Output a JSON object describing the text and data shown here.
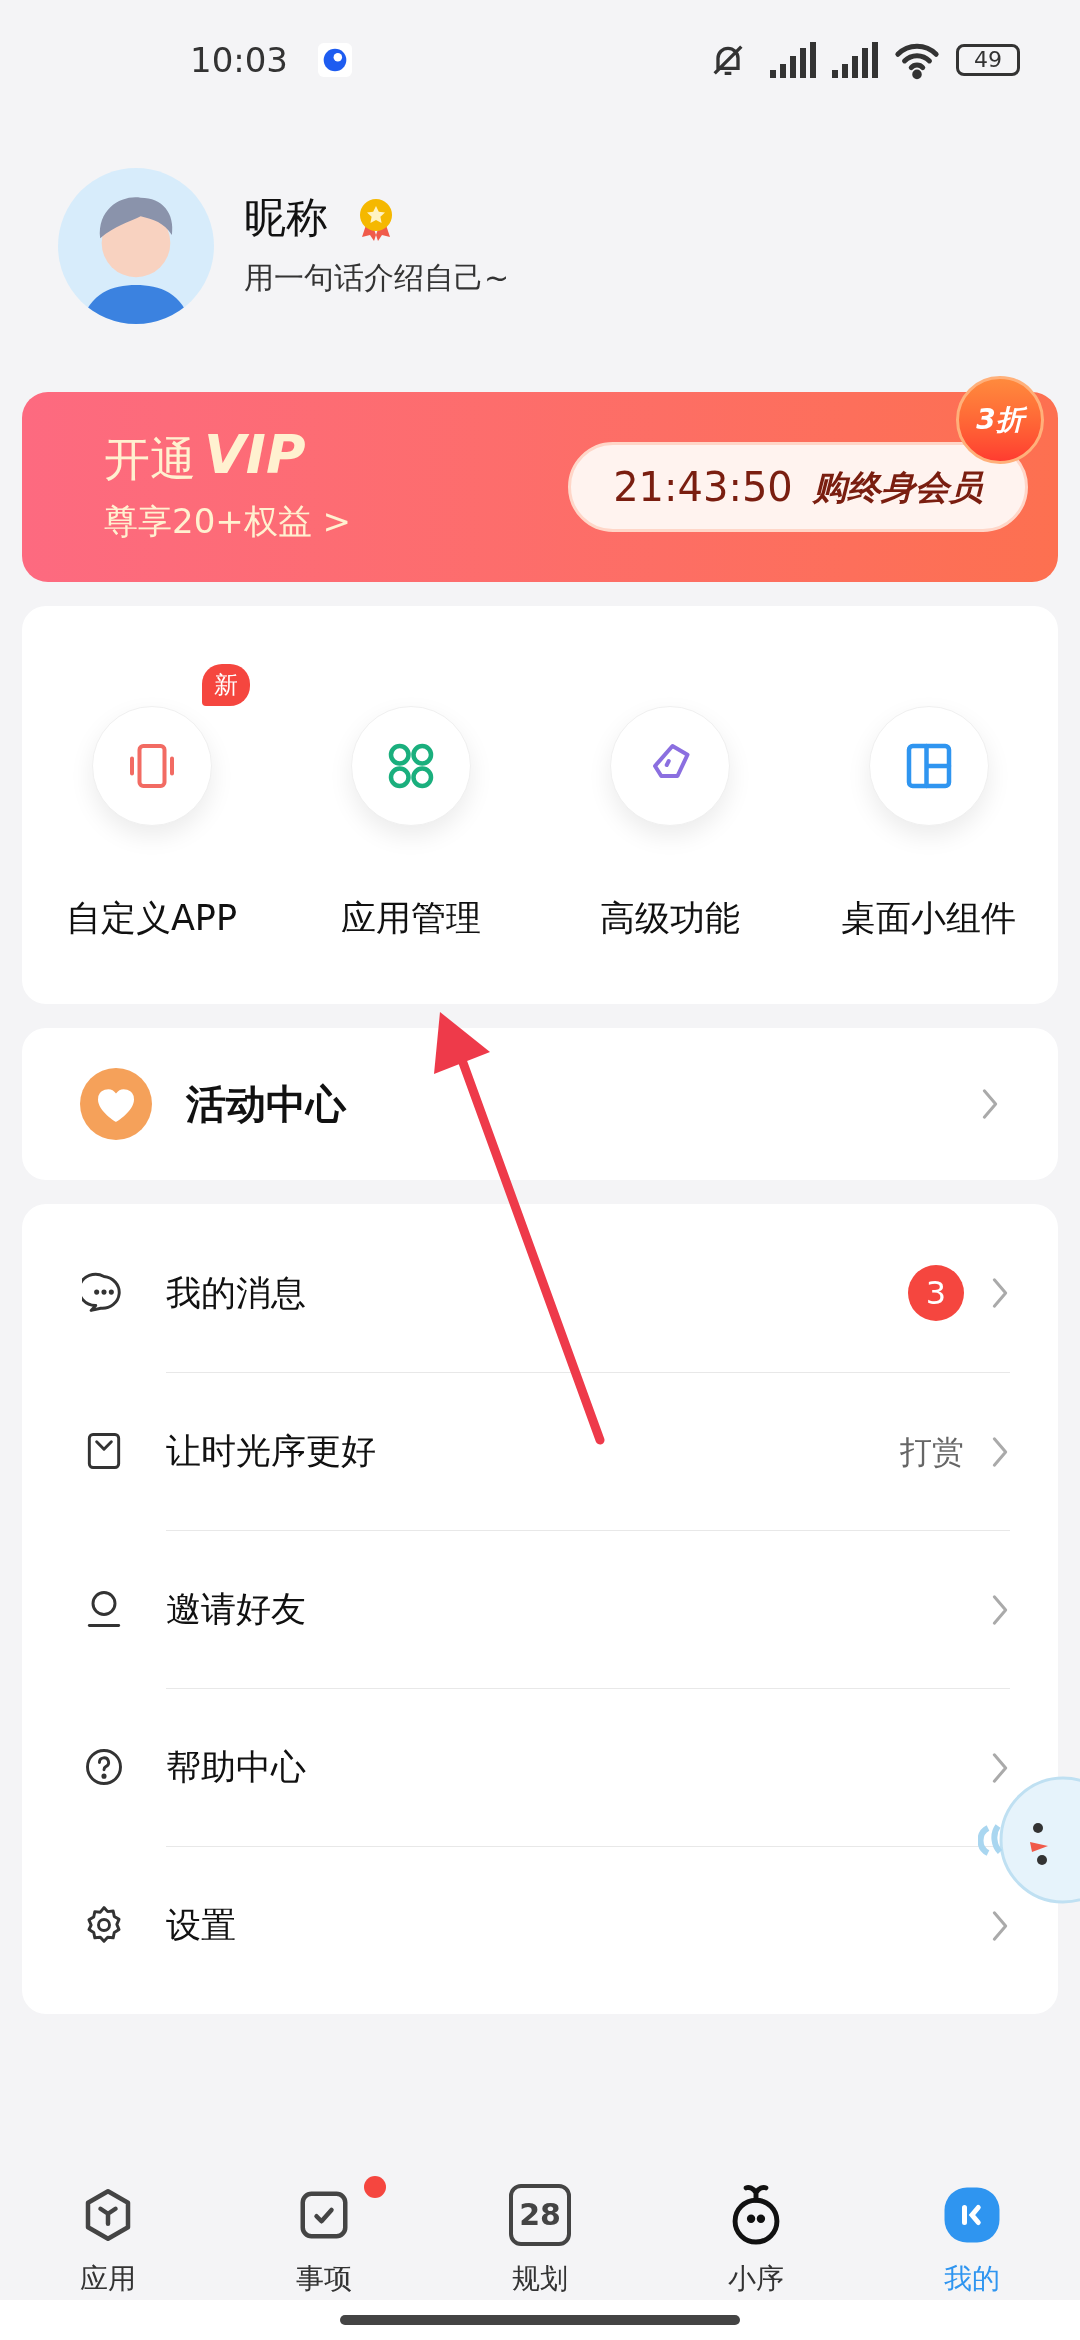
{
  "status_bar": {
    "time": "10:03",
    "battery": "49"
  },
  "profile": {
    "nickname": "昵称",
    "bio": "用一句话介绍自己~"
  },
  "vip_banner": {
    "title": "开通",
    "title_highlight": "VIP",
    "subtitle": "尊享20+权益 >",
    "countdown": "21:43:50",
    "cta": "购终身会员",
    "discount_badge": "3折"
  },
  "features": [
    {
      "label": "自定义APP",
      "kind": "phone",
      "badge": "新"
    },
    {
      "label": "应用管理",
      "kind": "apps"
    },
    {
      "label": "高级功能",
      "kind": "pen"
    },
    {
      "label": "桌面小组件",
      "kind": "layout"
    }
  ],
  "activity": {
    "label": "活动中心"
  },
  "menu": [
    {
      "label": "我的消息",
      "kind": "chat",
      "badge": "3"
    },
    {
      "label": "让时光序更好",
      "kind": "gift",
      "value": "打赏"
    },
    {
      "label": "邀请好友",
      "kind": "person"
    },
    {
      "label": "帮助中心",
      "kind": "help"
    },
    {
      "label": "设置",
      "kind": "gear"
    }
  ],
  "nav": [
    {
      "label": "应用",
      "kind": "hex",
      "selected": false,
      "dot": false
    },
    {
      "label": "事项",
      "kind": "check",
      "selected": false,
      "dot": true
    },
    {
      "label": "规划",
      "kind": "calendar",
      "selected": false,
      "dot": false,
      "number": "28"
    },
    {
      "label": "小序",
      "kind": "sprout",
      "selected": false,
      "dot": false
    },
    {
      "label": "我的",
      "kind": "mine",
      "selected": true,
      "dot": false
    }
  ]
}
